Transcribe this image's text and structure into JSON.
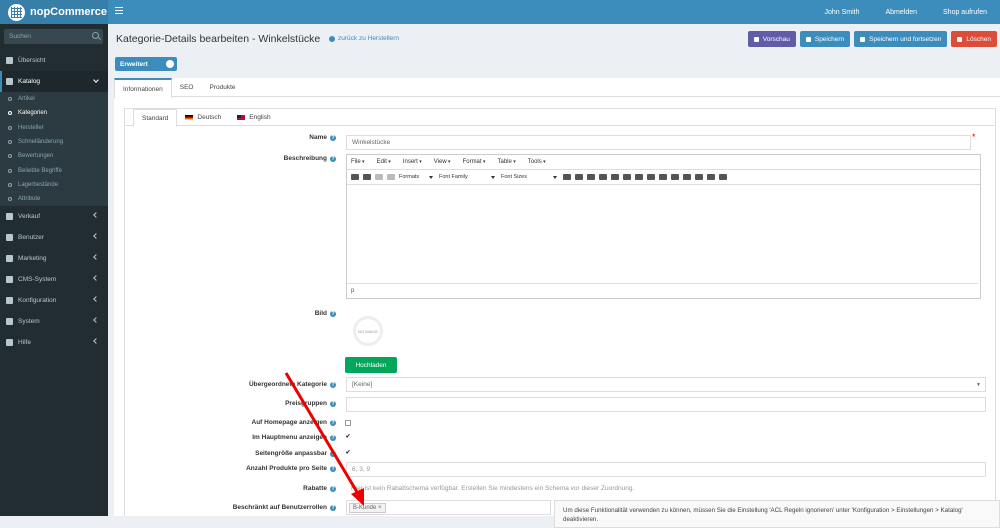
{
  "header": {
    "brand": "nopCommerce",
    "user": "John Smith",
    "logout": "Abmelden",
    "shop": "Shop aufrufen"
  },
  "sidebar": {
    "search_placeholder": "Suchen",
    "items": [
      {
        "label": "Übersicht",
        "icon": "desktop-icon"
      },
      {
        "label": "Katalog",
        "icon": "book-icon",
        "active": true
      },
      {
        "label": "Verkauf",
        "icon": "cart-icon"
      },
      {
        "label": "Benutzer",
        "icon": "user-icon"
      },
      {
        "label": "Marketing",
        "icon": "tag-icon"
      },
      {
        "label": "CMS-System",
        "icon": "pencil-icon"
      },
      {
        "label": "Konfiguration",
        "icon": "gears-icon"
      },
      {
        "label": "System",
        "icon": "cube-icon"
      },
      {
        "label": "Hilfe",
        "icon": "question-icon"
      }
    ],
    "subitems": [
      "Artikel",
      "Kategorien",
      "Hersteller",
      "Schnelländerung",
      "Bewertungen",
      "Beliebte Begriffe",
      "Lagerbestände",
      "Attribute"
    ]
  },
  "page": {
    "title": "Kategorie-Details bearbeiten - Winkelstücke",
    "back": "zurück zu Herstellern",
    "preview": "Vorschau",
    "save": "Speichern",
    "save_continue": "Speichern und fortsetzen",
    "delete": "Löschen",
    "advanced": "Erweitert"
  },
  "colors": {
    "header": "#3c8dbc",
    "preview": "#605ca8",
    "save": "#3c8dbc",
    "delete": "#dd4b39",
    "upload": "#00a65a",
    "sidebar": "#222d32"
  },
  "tabs": [
    "Informationen",
    "SEO",
    "Produkte"
  ],
  "langtabs": [
    "Standard",
    "Deutsch",
    "English"
  ],
  "form": {
    "name_label": "Name",
    "name_value": "Winkelstücke",
    "description_label": "Beschreibung",
    "editor_menu": [
      "File",
      "Edit",
      "Insert",
      "View",
      "Format",
      "Table",
      "Tools"
    ],
    "editor_formats": "Formats",
    "editor_font": "Font Family",
    "editor_size": "Font Sizes",
    "editor_status": "p",
    "picture_label": "Bild",
    "no_image": "NO IMAGE",
    "upload": "Hochladen",
    "parent_label": "Übergeordnete Kategorie",
    "parent_value": "[Keine]",
    "price_label": "Preisgruppen",
    "homepage_label": "Auf Homepage anzeigen",
    "homepage_checked": false,
    "topmenu_label": "Im Hauptmenu anzeigen",
    "topmenu_checked": true,
    "pagesize_label": "Seitengröße anpassbar",
    "pagesize_checked": true,
    "pagesize_options_label": "Anzahl Produkte pro Seite",
    "pagesize_options_value": "6, 3, 9",
    "discount_label": "Rabatte",
    "discount_value": "Hier ist kein Rabattschema verfügbar. Erstellen Sie mindestens ein Schema vor dieser Zuordnung.",
    "roles_label": "Beschränkt auf Benutzerrollen",
    "roles_tag": "B-Kunde ×",
    "roles_help": "Um diese Funktionalität verwenden zu können, müssen Sie die Einstellung 'ACL Regeln ignorieren' unter 'Konfiguration > Einstellungen > Katalog' deaktivieren."
  }
}
